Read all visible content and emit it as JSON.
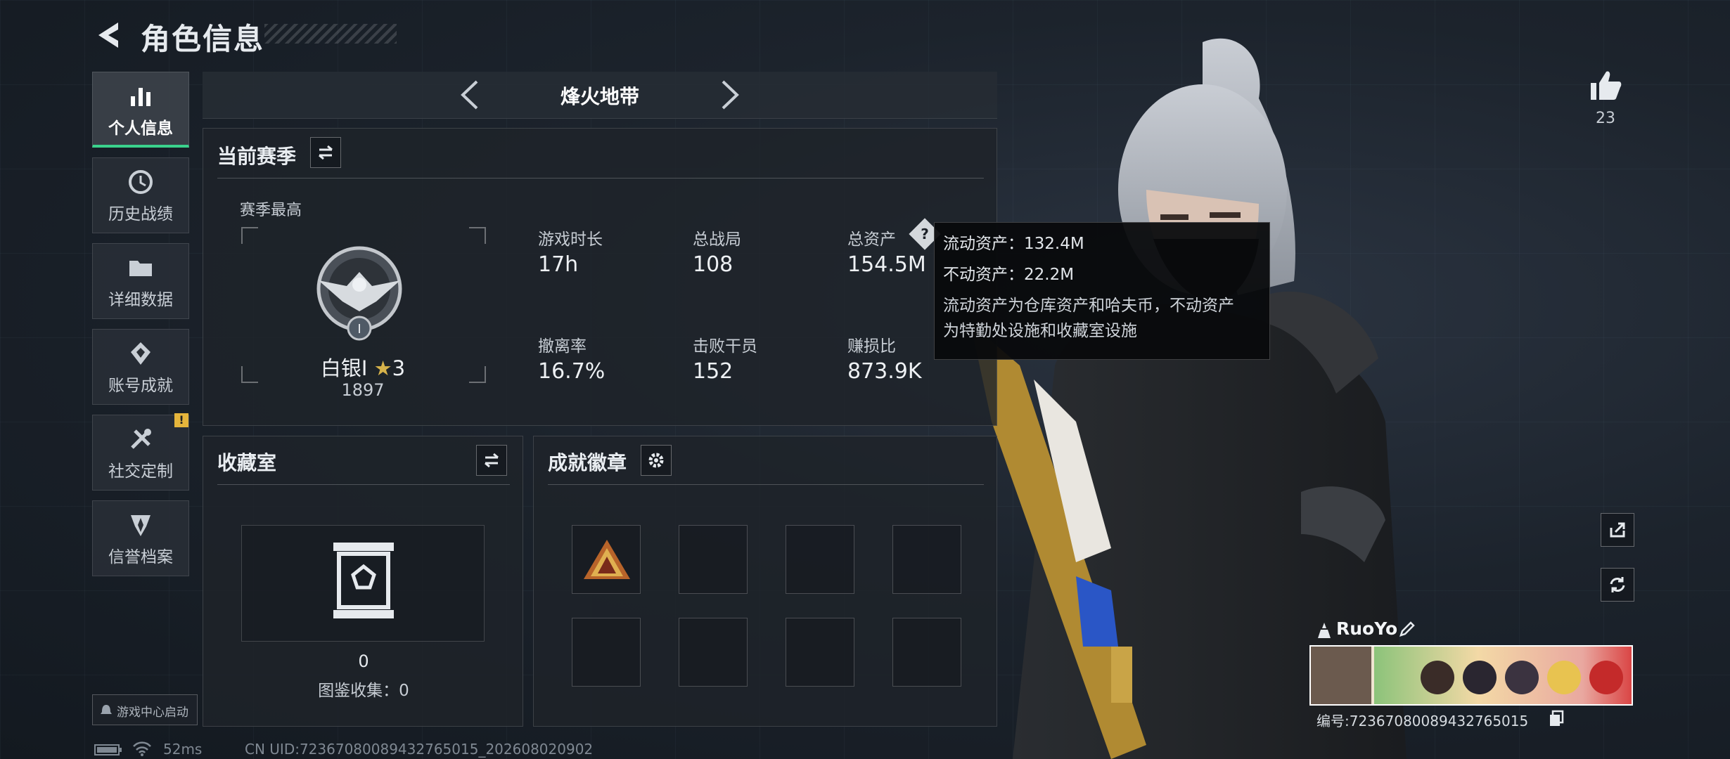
{
  "header": {
    "title": "角色信息"
  },
  "sidebar": {
    "items": [
      {
        "label": "个人信息",
        "icon": "bar-chart-icon",
        "active": true
      },
      {
        "label": "历史战绩",
        "icon": "history-icon"
      },
      {
        "label": "详细数据",
        "icon": "folder-icon"
      },
      {
        "label": "账号成就",
        "icon": "achievement-icon"
      },
      {
        "label": "社交定制",
        "icon": "tools-icon",
        "badge": "!"
      },
      {
        "label": "信誉档案",
        "icon": "shield-icon"
      }
    ],
    "launch_label": "游戏中心启动"
  },
  "mode": {
    "name": "烽火地带"
  },
  "season": {
    "title": "当前赛季",
    "best_label": "赛季最高",
    "rank_name": "白银I",
    "rank_stars": "3",
    "rank_score": "1897",
    "rank_tier_numeral": "I",
    "stats": [
      {
        "label": "游戏时长",
        "value": "17h"
      },
      {
        "label": "总战局",
        "value": "108"
      },
      {
        "label": "总资产",
        "value": "154.5M",
        "help": "?"
      },
      {
        "label": "撤离率",
        "value": "16.7%"
      },
      {
        "label": "击败干员",
        "value": "152"
      },
      {
        "label": "赚损比",
        "value": "873.9K"
      }
    ]
  },
  "tooltip": {
    "line1": "流动资产：132.4M",
    "line2": "不动资产：22.2M",
    "desc1": "流动资产为仓库资产和哈夫币，不动资产",
    "desc2": "为特勤处设施和收藏室设施"
  },
  "collection": {
    "title": "收藏室",
    "count": "0",
    "catalog": "图鉴收集：0"
  },
  "badges": {
    "title": "成就徽章"
  },
  "likes": {
    "count": "23"
  },
  "player": {
    "name": "RuoYo",
    "id_text": "编号:72367080089432765015"
  },
  "status": {
    "ping": "52ms",
    "uid": "CN UID:72367080089432765015_202608020902"
  },
  "colors": {
    "accent": "#3ad28c",
    "warning": "#e5b53c"
  }
}
